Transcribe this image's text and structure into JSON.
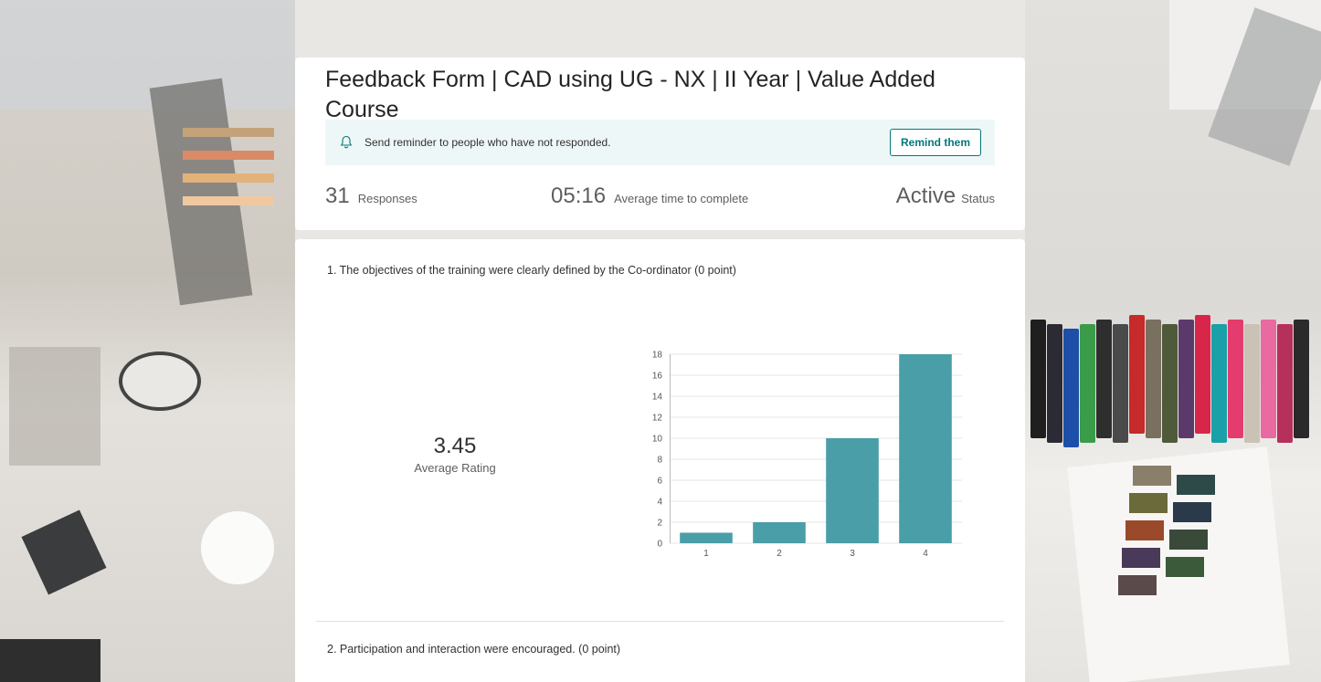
{
  "form": {
    "title": "Feedback Form | CAD using UG - NX | II Year | Value Added Course"
  },
  "reminder": {
    "icon": "bell-icon",
    "text": "Send reminder to people who have not responded.",
    "button_label": "Remind them"
  },
  "stats": {
    "responses_value": "31",
    "responses_label": "Responses",
    "avg_time_value": "05:16",
    "avg_time_label": "Average time to complete",
    "status_value": "Active",
    "status_label": "Status"
  },
  "questions": [
    {
      "title": "1.  The objectives of the training were clearly defined by the Co-ordinator (0 point)",
      "average_value": "3.45",
      "average_label": "Average Rating"
    },
    {
      "title": "2.  Participation and interaction were encouraged. (0 point)"
    }
  ],
  "colors": {
    "accent": "#03787c",
    "bar": "#4a9ea8",
    "reminder_bg": "#eef7f7"
  },
  "chart_data": {
    "type": "bar",
    "categories": [
      "1",
      "2",
      "3",
      "4"
    ],
    "values": [
      1,
      2,
      10,
      18
    ],
    "yticks": [
      0,
      2,
      4,
      6,
      8,
      10,
      12,
      14,
      16,
      18
    ],
    "ylim": [
      0,
      18
    ],
    "grid": true
  }
}
